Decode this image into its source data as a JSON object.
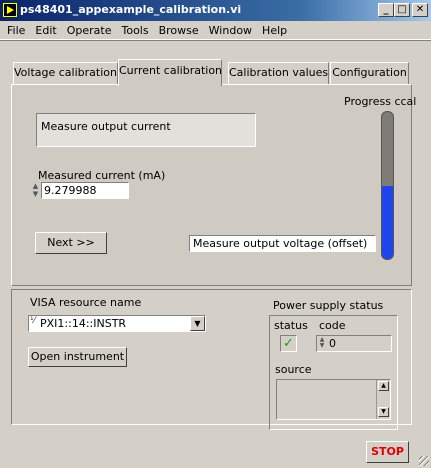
{
  "window": {
    "title": "ps48401_appexample_calibration.vi",
    "controls": {
      "minimize": "_",
      "maximize": "□",
      "close": "✕"
    }
  },
  "menu": [
    "File",
    "Edit",
    "Operate",
    "Tools",
    "Browse",
    "Window",
    "Help"
  ],
  "tabs": {
    "items": [
      "Voltage calibration",
      "Current calibration",
      "Calibration values",
      "Configuration"
    ],
    "active": "Current calibration"
  },
  "current_calibration": {
    "status_text": "Measure output current",
    "progress_label": "Progress ccal",
    "progress_fraction": 0.5,
    "measured_current_label": "Measured current (mA)",
    "measured_current_value": "9.279988",
    "next_button": "Next >>",
    "next_step_text": "Measure output voltage (offset)"
  },
  "visa": {
    "label": "VISA resource name",
    "io_icon": "⅟",
    "value": "PXI1::14::INSTR",
    "dropdown_icon": "▼"
  },
  "open_button": "Open instrument",
  "power_supply": {
    "label": "Power supply status",
    "status_label": "status",
    "status_icon": "✓",
    "code_label": "code",
    "code_value": "0",
    "source_label": "source",
    "source_value": ""
  },
  "stop_button": "STOP",
  "colors": {
    "progress_fill": "#1e44ee",
    "status_ok": "#1a9b1a",
    "stop_text": "#e00000"
  }
}
